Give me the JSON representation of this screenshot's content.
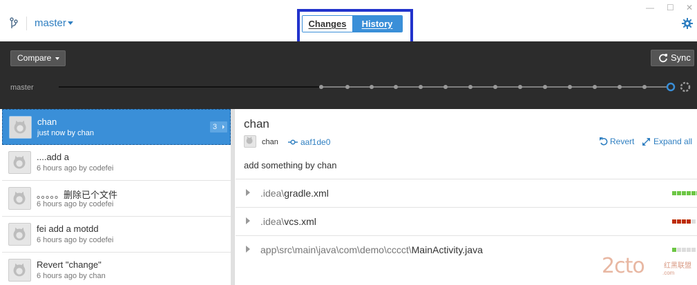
{
  "header": {
    "branch": "master",
    "tabs": [
      {
        "label": "Changes",
        "active": false
      },
      {
        "label": "History",
        "active": true
      }
    ],
    "window_controls": [
      "—",
      "☐",
      "✕"
    ]
  },
  "toolbar": {
    "compare_label": "Compare",
    "sync_label": "Sync",
    "timeline_branch": "master"
  },
  "commits": [
    {
      "title": "chan",
      "meta": "just now by chan",
      "count": "3",
      "selected": true
    },
    {
      "title": "....add a",
      "meta": "6 hours ago by codefei",
      "selected": false
    },
    {
      "title": "。。。。。删除已个文件",
      "meta": "6 hours ago by codefei",
      "selected": false
    },
    {
      "title": "fei add a motdd",
      "meta": "6 hours ago by codefei",
      "selected": false
    },
    {
      "title": "Revert \"change\"",
      "meta": "6 hours ago by chan",
      "selected": false
    }
  ],
  "detail": {
    "title": "chan",
    "author": "chan",
    "sha": "aaf1de0",
    "revert_label": "Revert",
    "expand_label": "Expand all",
    "message": "add something by chan"
  },
  "files": [
    {
      "dir": ".idea\\",
      "name": "gradle.xml",
      "diff": [
        "add",
        "add",
        "add",
        "add",
        "add",
        "add"
      ]
    },
    {
      "dir": ".idea\\",
      "name": "vcs.xml",
      "diff": [
        "del",
        "del",
        "del",
        "del",
        "none"
      ]
    },
    {
      "dir": "app\\src\\main\\java\\com\\demo\\cccct\\",
      "name": "MainActivity.java",
      "diff": [
        "add",
        "none",
        "none",
        "none",
        "none"
      ]
    }
  ],
  "colors": {
    "accent": "#3a8fd8",
    "link": "#2f7fc1",
    "dark_band": "#2c2c2c",
    "diff_add": "#6cc644",
    "diff_del": "#bd2c00",
    "diff_none": "#dddddd"
  },
  "watermark": {
    "logo": "2cto",
    "tag": "红黑联盟",
    "sub": ".com"
  }
}
